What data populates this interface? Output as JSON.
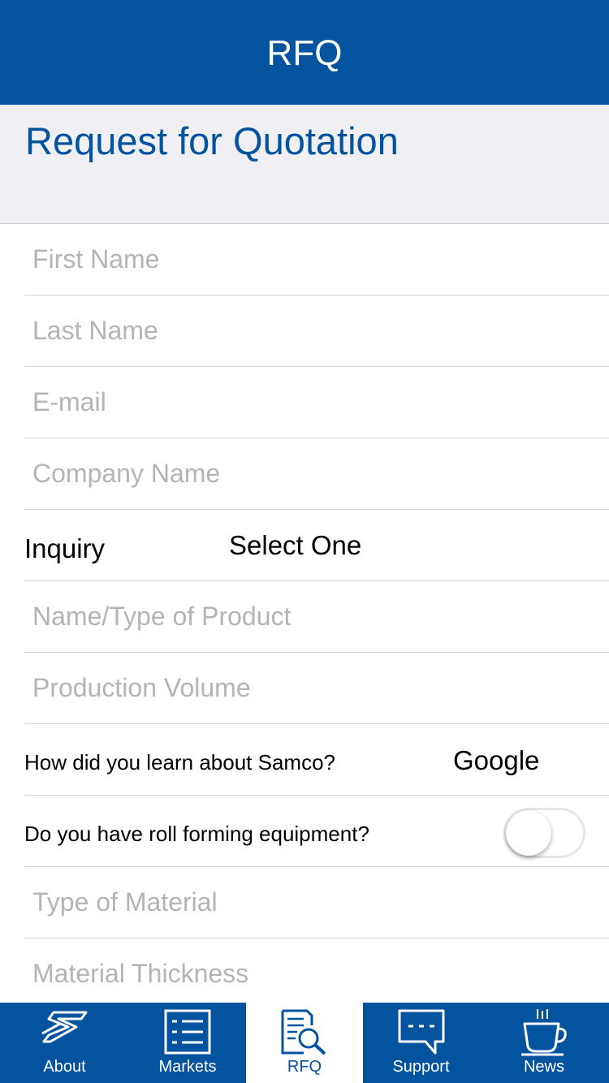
{
  "navbar": {
    "title": "RFQ"
  },
  "page": {
    "title": "Request for Quotation"
  },
  "form": {
    "first_name_placeholder": "First Name",
    "last_name_placeholder": "Last Name",
    "email_placeholder": "E-mail",
    "company_placeholder": "Company Name",
    "inquiry_label": "Inquiry",
    "inquiry_value": "Select One",
    "product_placeholder": "Name/Type of Product",
    "volume_placeholder": "Production Volume",
    "learn_label": "How did you learn about Samco?",
    "learn_value": "Google",
    "equipment_label": "Do you have roll forming equipment?",
    "equipment_on": false,
    "material_placeholder": "Type of Material",
    "thickness_placeholder": "Material Thickness"
  },
  "tabbar": {
    "accent": "#03539f",
    "tabs": [
      {
        "label": "About",
        "icon": "samco-logo-icon"
      },
      {
        "label": "Markets",
        "icon": "list-icon"
      },
      {
        "label": "RFQ",
        "icon": "document-search-icon",
        "active": true
      },
      {
        "label": "Support",
        "icon": "chat-bubble-icon"
      },
      {
        "label": "News",
        "icon": "coffee-cup-icon"
      }
    ]
  }
}
